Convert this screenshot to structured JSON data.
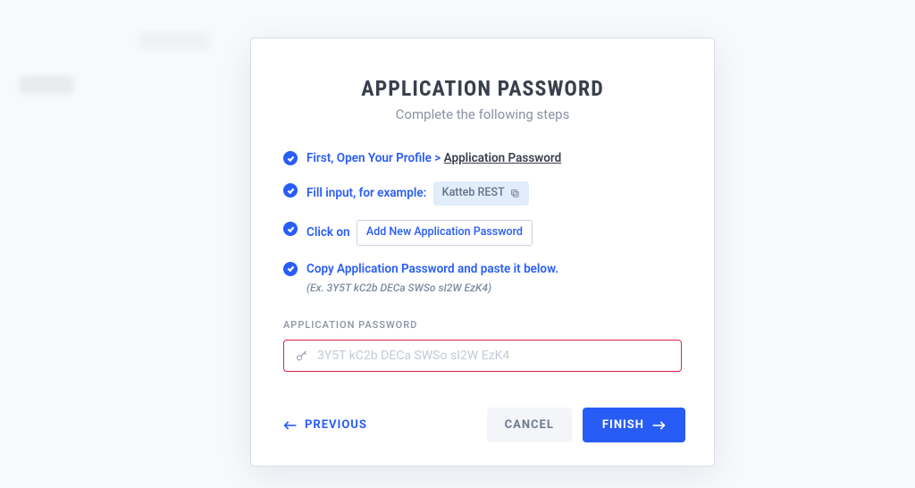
{
  "modal": {
    "title": "APPLICATION PASSWORD",
    "subtitle": "Complete the following steps",
    "steps": [
      {
        "prefix": "First, Open Your Profile > ",
        "link": "Application Password"
      },
      {
        "text": "Fill input, for example:",
        "chip": "Katteb REST"
      },
      {
        "text": "Click on",
        "button": "Add New Application Password"
      },
      {
        "text": "Copy Application Password and paste it below.",
        "hint": "(Ex. 3Y5T kC2b DECa SWSo sI2W EzK4)"
      }
    ],
    "field_label": "APPLICATION PASSWORD",
    "password_placeholder": "3Y5T kC2b DECa SWSo sI2W EzK4",
    "password_value": "",
    "previous_label": "PREVIOUS",
    "cancel_label": "CANCEL",
    "finish_label": "FINISH"
  }
}
